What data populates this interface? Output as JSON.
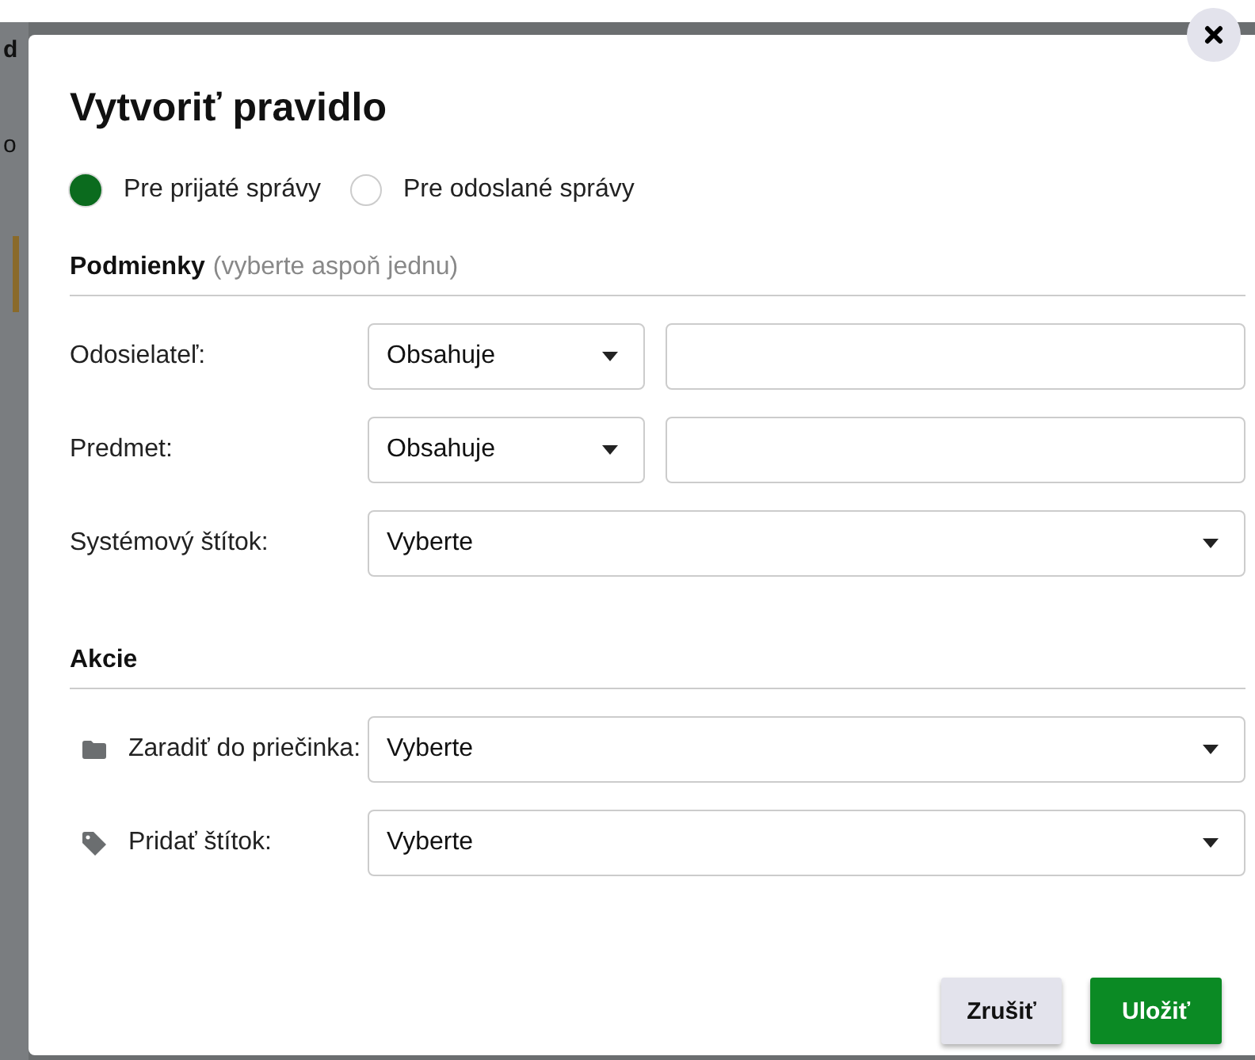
{
  "background": {
    "fragments": [
      "d",
      "o"
    ]
  },
  "dialog": {
    "title": "Vytvoriť pravidlo",
    "direction": [
      {
        "label": "Pre prijaté správy",
        "selected": true
      },
      {
        "label": "Pre odoslané správy",
        "selected": false
      }
    ],
    "conditions": {
      "heading": "Podmienky",
      "hint": "(vyberte aspoň jednu)",
      "rows": [
        {
          "kind": "match",
          "label": "Odosielateľ:",
          "operator": "Obsahuje"
        },
        {
          "kind": "match",
          "label": "Predmet:",
          "operator": "Obsahuje"
        },
        {
          "kind": "select",
          "label": "Systémový štítok:",
          "value": "Vyberte"
        }
      ]
    },
    "actions": {
      "heading": "Akcie",
      "rows": [
        {
          "kind": "folder",
          "label": "Zaradiť do priečinka:",
          "value": "Vyberte"
        },
        {
          "kind": "tag",
          "label": "Pridať štítok:",
          "value": "Vyberte"
        }
      ]
    },
    "buttons": [
      {
        "kind": "secondary",
        "label": "Zrušiť"
      },
      {
        "kind": "primary",
        "label": "Uložiť"
      }
    ]
  }
}
